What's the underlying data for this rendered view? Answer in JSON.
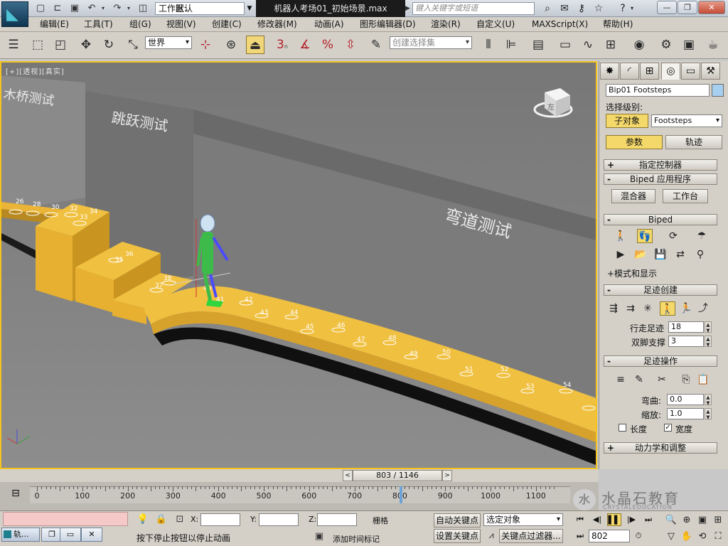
{
  "titlebar": {
    "workspace_prefix": "工作区:",
    "workspace_value": "默认",
    "document_title": "机器人考场01_初始场景.max",
    "search_placeholder": "键入关键字或短语"
  },
  "menu": [
    "编辑(E)",
    "工具(T)",
    "组(G)",
    "视图(V)",
    "创建(C)",
    "修改器(M)",
    "动画(A)",
    "图形编辑器(D)",
    "渲染(R)",
    "自定义(U)",
    "MAXScript(X)",
    "帮助(H)"
  ],
  "toolbar": {
    "coord_system": "世界",
    "selection_set_placeholder": "创建选择集",
    "snap_label": "3",
    "snap_sub": "n"
  },
  "viewport": {
    "label": "[+][透视][真实]",
    "viewcube_face": "左",
    "wall_texts": [
      "木桥测试",
      "跳跃测试",
      "弯道测试"
    ],
    "footstep_numbers": [
      "26",
      "28",
      "30",
      "32",
      "33",
      "34",
      "35",
      "36",
      "37",
      "38",
      "40",
      "41",
      "42",
      "43",
      "44",
      "45",
      "46",
      "47",
      "48",
      "49",
      "50",
      "51",
      "52",
      "53",
      "54"
    ]
  },
  "command_panel": {
    "object_name": "Bip01 Footsteps",
    "object_color": "#a7d0f0",
    "select_level_label": "选择级别:",
    "sub_object_btn": "子对象",
    "sub_object_value": "Footsteps",
    "params_btn": "参数",
    "trajectory_btn": "轨迹",
    "rollout_assign": "指定控制器",
    "rollout_apps": "Biped 应用程序",
    "mixer_btn": "混合器",
    "workbench_btn": "工作台",
    "rollout_biped": "Biped",
    "modes_display": "+模式和显示",
    "rollout_fs_create": "足迹创建",
    "walk_steps_label": "行走足迹",
    "walk_steps_value": "18",
    "double_support_label": "双脚支撑",
    "double_support_value": "3",
    "rollout_fs_ops": "足迹操作",
    "bend_label": "弯曲:",
    "bend_value": "0.0",
    "scale_label": "缩放:",
    "scale_value": "1.0",
    "length_label": "长度",
    "length_checked": false,
    "width_label": "宽度",
    "width_checked": true,
    "rollout_dynamics": "动力学和调整"
  },
  "timeline": {
    "slider_text": "803 / 1146",
    "current_frame": 803,
    "total_frames": 1146,
    "ticks": [
      "0",
      "100",
      "200",
      "300",
      "400",
      "500",
      "600",
      "700",
      "800",
      "900",
      "1000",
      "1100"
    ]
  },
  "status": {
    "taskbar_item": "轨...",
    "x_label": "X:",
    "y_label": "Y:",
    "z_label": "Z:",
    "grid_label": "栅格",
    "prompt": "按下停止按钮以停止动画",
    "add_time_tag": "添加时间标记",
    "auto_key": "自动关键点",
    "set_key": "设置关键点",
    "selected_object": "选定对象",
    "key_filters": "关键点过滤器...",
    "frame_value": "802"
  },
  "watermark": {
    "logo_text": "水",
    "title": "水晶石教育",
    "subtitle": "CRYSTALEDUCATION"
  }
}
